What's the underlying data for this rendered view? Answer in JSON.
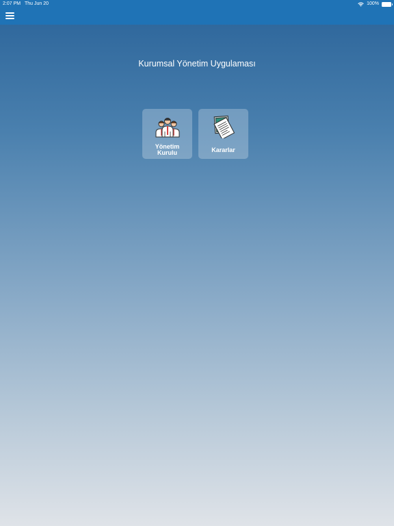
{
  "status_bar": {
    "time": "2:07 PM",
    "date": "Thu Jun 20",
    "battery": "100%",
    "icons": [
      "wifi-icon",
      "battery-icon"
    ]
  },
  "nav": {
    "menu_icon": "hamburger-menu-icon"
  },
  "main": {
    "title": "Kurumsal Yönetim Uygulaması",
    "tiles": [
      {
        "label_line1": "Yönetim",
        "label_line2": "Kurulu",
        "icon": "team-people-icon"
      },
      {
        "label": "Kararlar",
        "icon": "documents-icon"
      }
    ]
  },
  "colors": {
    "nav_bar": "#1f73b6",
    "gradient_top": "#2a6399",
    "gradient_bottom": "#dfe3e8",
    "tile_bg": "rgba(255,255,255,0.25)"
  }
}
